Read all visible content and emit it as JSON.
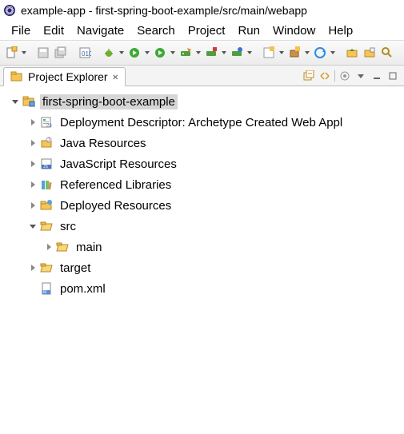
{
  "title": "example-app - first-spring-boot-example/src/main/webapp",
  "menu": [
    "File",
    "Edit",
    "Navigate",
    "Search",
    "Project",
    "Run",
    "Window",
    "Help"
  ],
  "panel": {
    "title": "Project Explorer",
    "close_glyph": "✕"
  },
  "tree": {
    "root": {
      "label": "first-spring-boot-example",
      "expanded": true,
      "selected": true,
      "children": [
        {
          "icon": "deploy-descriptor",
          "label": "Deployment Descriptor: Archetype Created Web Appl",
          "expandable": true,
          "expanded": false
        },
        {
          "icon": "java-resources",
          "label": "Java Resources",
          "expandable": true,
          "expanded": false
        },
        {
          "icon": "js-resources",
          "label": "JavaScript Resources",
          "expandable": true,
          "expanded": false
        },
        {
          "icon": "ref-libraries",
          "label": "Referenced Libraries",
          "expandable": true,
          "expanded": false
        },
        {
          "icon": "deployed-resources",
          "label": "Deployed Resources",
          "expandable": true,
          "expanded": false
        },
        {
          "icon": "folder-open",
          "label": "src",
          "expandable": true,
          "expanded": true,
          "children": [
            {
              "icon": "folder-open",
              "label": "main",
              "expandable": true,
              "expanded": false
            }
          ]
        },
        {
          "icon": "folder-open",
          "label": "target",
          "expandable": true,
          "expanded": false
        },
        {
          "icon": "xml-file",
          "label": "pom.xml",
          "expandable": false
        }
      ]
    }
  }
}
